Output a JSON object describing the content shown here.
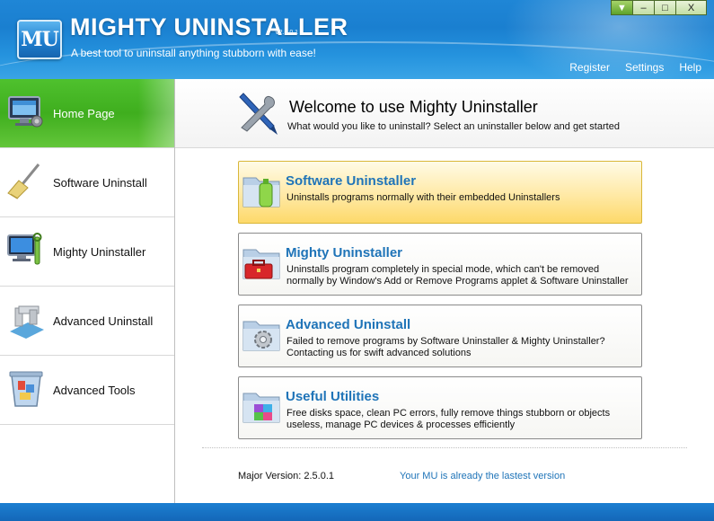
{
  "header": {
    "title": "MIGHTY UNINSTALLER",
    "version": "V2.5.0.1",
    "tagline": "A best tool to uninstall anything stubborn with ease!",
    "logo_text": "MU",
    "links": {
      "register": "Register",
      "settings": "Settings",
      "help": "Help"
    },
    "window_buttons": {
      "menu": "▼",
      "minimize": "–",
      "restore": "□",
      "close": "X"
    }
  },
  "sidebar": {
    "items": [
      {
        "label": "Home Page",
        "icon": "home-monitor-icon",
        "active": true
      },
      {
        "label": "Software Uninstall",
        "icon": "broom-icon",
        "active": false
      },
      {
        "label": "Mighty Uninstaller",
        "icon": "computer-wrench-icon",
        "active": false
      },
      {
        "label": "Advanced Uninstall",
        "icon": "pipes-icon",
        "active": false
      },
      {
        "label": "Advanced Tools",
        "icon": "recycle-bin-icon",
        "active": false
      }
    ]
  },
  "welcome": {
    "title": "Welcome to use Mighty Uninstaller",
    "subtitle": "What would you like to uninstall? Select an uninstaller below and get started"
  },
  "cards": [
    {
      "title": "Software Uninstaller",
      "desc": "Uninstalls programs normally with their embedded Uninstallers",
      "icon": "folder-bottle-icon",
      "highlighted": true
    },
    {
      "title": "Mighty Uninstaller",
      "desc": "Uninstalls program completely in special mode, which can't be removed normally by Window's Add or Remove Programs applet & Software Uninstaller",
      "icon": "folder-toolbox-icon",
      "highlighted": false
    },
    {
      "title": "Advanced Uninstall",
      "desc": "Failed to remove programs by Software Uninstaller & Mighty Uninstaller? Contacting us for swift advanced solutions",
      "icon": "folder-gear-icon",
      "highlighted": false
    },
    {
      "title": "Useful Utilities",
      "desc": "Free disks space, clean PC errors, fully remove things stubborn or objects useless, manage PC devices & processes efficiently",
      "icon": "folder-blocks-icon",
      "highlighted": false
    }
  ],
  "footer": {
    "version_label": "Major Version: 2.5.0.1",
    "status": "Your MU is already the lastest version"
  },
  "colors": {
    "header_blue": "#1f86d6",
    "active_green": "#4fc12e",
    "card_highlight": "#fde08a",
    "link_blue": "#1f74b8"
  }
}
